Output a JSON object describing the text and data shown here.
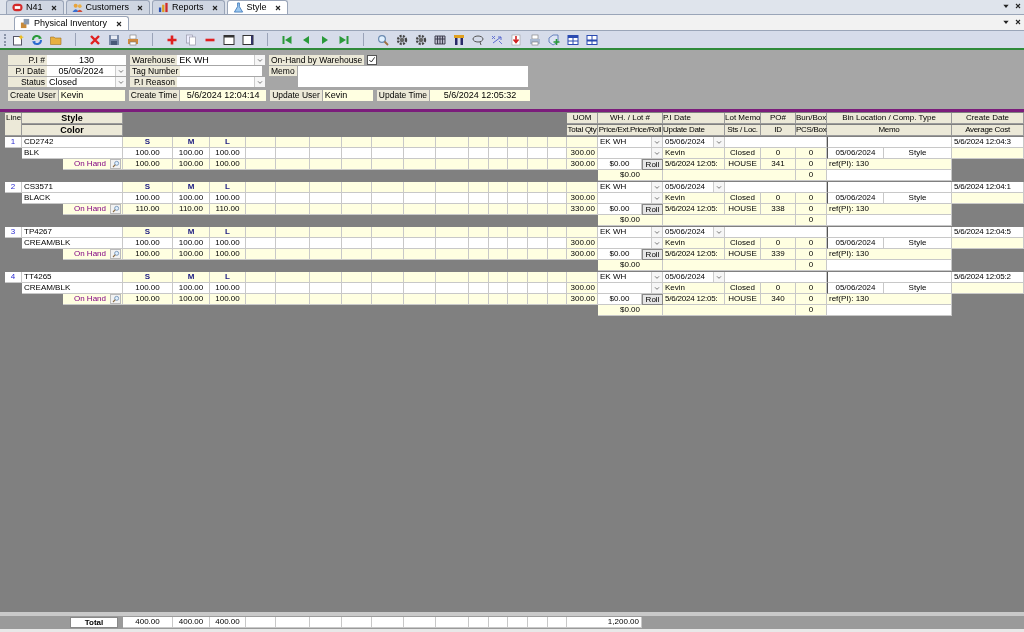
{
  "tabs": [
    {
      "label": "N41",
      "selected": false
    },
    {
      "label": "Customers",
      "selected": false
    },
    {
      "label": "Reports",
      "selected": false
    },
    {
      "label": "Style",
      "selected": true
    }
  ],
  "subtabs": [
    {
      "label": "Physical Inventory",
      "selected": true
    }
  ],
  "form": {
    "pi_number": {
      "label": "P.I #",
      "value": "130"
    },
    "pi_date": {
      "label": "P.I Date",
      "value": "05/06/2024"
    },
    "status": {
      "label": "Status",
      "value": "Closed"
    },
    "warehouse": {
      "label": "Warehouse",
      "value": "EK WH"
    },
    "tag_number": {
      "label": "Tag Number"
    },
    "pi_reason": {
      "label": "P.I Reason"
    },
    "onhand_by_warehouse": {
      "label": "On-Hand by Warehouse",
      "checked": true
    },
    "memo": {
      "label": "Memo"
    },
    "create_user": {
      "label": "Create User",
      "value": "Kevin"
    },
    "create_time": {
      "label": "Create Time",
      "value": "5/6/2024 12:04:14"
    },
    "update_user": {
      "label": "Update User",
      "value": "Kevin"
    },
    "update_time": {
      "label": "Update Time",
      "value": "5/6/2024 12:05:32"
    }
  },
  "grid": {
    "header": {
      "line": "Line",
      "style": "Style",
      "color_label": "Color",
      "columns": [
        {
          "top": "UOM",
          "bottom": "Total Qty"
        },
        {
          "top": "WH. / Lot #",
          "bottom": "Price/Ext.Price/Roll"
        },
        {
          "top": "P.I Date",
          "bottom": "Update Date"
        },
        {
          "top": "Lot Memo",
          "bottom": "Sts / Loc."
        },
        {
          "top": "PO#",
          "bottom": "ID"
        },
        {
          "top": "Bun/Box",
          "bottom": "PCS/Box"
        },
        {
          "top": "Bin Location / Comp. Type",
          "bottom": "Memo"
        },
        {
          "top": "Create Date",
          "bottom": "Average Cost"
        }
      ]
    },
    "items": [
      {
        "line": "1",
        "style": "CD2742",
        "color_name": "BLK",
        "sizes": [
          "S",
          "M",
          "L"
        ],
        "qty": [
          "100.00",
          "100.00",
          "100.00"
        ],
        "onhand_label": "On Hand",
        "onhand": [
          "100.00",
          "100.00",
          "100.00"
        ],
        "total_qty": "300.00",
        "onhand_total": "300.00",
        "warehouse": "EK WH",
        "pi_date": "05/06/2024",
        "create_date": "5/6/2024 12:04:3",
        "user": "Kevin",
        "status": "Closed",
        "po": "0",
        "bun_box": "0",
        "bin_date": "05/06/2024",
        "comp_type": "Style",
        "price": "$0.00",
        "roll": "Roll",
        "update_date": "5/6/2024 12:05:",
        "location": "HOUSE",
        "id": "341",
        "pcs_box": "0",
        "memo": "ref(PI): 130",
        "ext_price": "$0.00",
        "bun_total": "0"
      },
      {
        "line": "2",
        "style": "CS3571",
        "color_name": "BLACK",
        "sizes": [
          "S",
          "M",
          "L"
        ],
        "qty": [
          "100.00",
          "100.00",
          "100.00"
        ],
        "onhand_label": "On Hand",
        "onhand": [
          "110.00",
          "110.00",
          "110.00"
        ],
        "total_qty": "300.00",
        "onhand_total": "330.00",
        "warehouse": "EK WH",
        "pi_date": "05/06/2024",
        "create_date": "5/6/2024 12:04:1",
        "user": "Kevin",
        "status": "Closed",
        "po": "0",
        "bun_box": "0",
        "bin_date": "05/06/2024",
        "comp_type": "Style",
        "price": "$0.00",
        "roll": "Roll",
        "update_date": "5/6/2024 12:05:",
        "location": "HOUSE",
        "id": "338",
        "pcs_box": "0",
        "memo": "ref(PI): 130",
        "ext_price": "$0.00",
        "bun_total": "0"
      },
      {
        "line": "3",
        "style": "TP4267",
        "color_name": "CREAM/BLK",
        "sizes": [
          "S",
          "M",
          "L"
        ],
        "qty": [
          "100.00",
          "100.00",
          "100.00"
        ],
        "onhand_label": "On Hand",
        "onhand": [
          "100.00",
          "100.00",
          "100.00"
        ],
        "total_qty": "300.00",
        "onhand_total": "300.00",
        "warehouse": "EK WH",
        "pi_date": "05/06/2024",
        "create_date": "5/6/2024 12:04:5",
        "user": "Kevin",
        "status": "Closed",
        "po": "0",
        "bun_box": "0",
        "bin_date": "05/06/2024",
        "comp_type": "Style",
        "price": "$0.00",
        "roll": "Roll",
        "update_date": "5/6/2024 12:05:",
        "location": "HOUSE",
        "id": "339",
        "pcs_box": "0",
        "memo": "ref(PI): 130",
        "ext_price": "$0.00",
        "bun_total": "0"
      },
      {
        "line": "4",
        "style": "TT4265",
        "color_name": "CREAM/BLK",
        "sizes": [
          "S",
          "M",
          "L"
        ],
        "qty": [
          "100.00",
          "100.00",
          "100.00"
        ],
        "onhand_label": "On Hand",
        "onhand": [
          "100.00",
          "100.00",
          "100.00"
        ],
        "total_qty": "300.00",
        "onhand_total": "300.00",
        "warehouse": "EK WH",
        "pi_date": "05/06/2024",
        "create_date": "5/6/2024 12:05:2",
        "user": "Kevin",
        "status": "Closed",
        "po": "0",
        "bun_box": "0",
        "bin_date": "05/06/2024",
        "comp_type": "Style",
        "price": "$0.00",
        "roll": "Roll",
        "update_date": "5/6/2024 12:05:",
        "location": "HOUSE",
        "id": "340",
        "pcs_box": "0",
        "memo": "ref(PI): 130",
        "ext_price": "$0.00",
        "bun_total": "0"
      }
    ],
    "totals": {
      "label": "Total",
      "sizes": [
        "400.00",
        "400.00",
        "400.00"
      ],
      "total_qty": "1,200.00"
    }
  }
}
